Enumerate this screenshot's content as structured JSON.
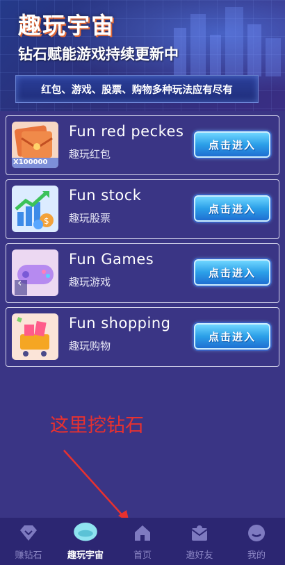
{
  "banner": {
    "title": "趣玩宇宙",
    "subtitle": "钻石赋能游戏持续更新中",
    "ribbon": "红包、游戏、股票、购物多种玩法应有尽有"
  },
  "cards": [
    {
      "title": "Fun red peckes",
      "subtitle": "趣玩红包",
      "button": "点击进入",
      "thumb_text": "X100000"
    },
    {
      "title": "Fun stock",
      "subtitle": "趣玩股票",
      "button": "点击进入"
    },
    {
      "title": "Fun Games",
      "subtitle": "趣玩游戏",
      "button": "点击进入"
    },
    {
      "title": "Fun shopping",
      "subtitle": "趣玩购物",
      "button": "点击进入"
    }
  ],
  "annotation": "这里挖钻石",
  "tabbar": {
    "items": [
      {
        "label": "赚钻石",
        "icon": "diamond-icon",
        "active": false
      },
      {
        "label": "趣玩宇宙",
        "icon": "planet-icon",
        "active": true
      },
      {
        "label": "首页",
        "icon": "home-icon",
        "active": false
      },
      {
        "label": "邀好友",
        "icon": "invite-icon",
        "active": false
      },
      {
        "label": "我的",
        "icon": "profile-icon",
        "active": false
      }
    ]
  },
  "colors": {
    "background": "#3a3585",
    "tabbar": "#2c2672",
    "annotation": "#e8312f",
    "button": "#2b9fe8"
  }
}
